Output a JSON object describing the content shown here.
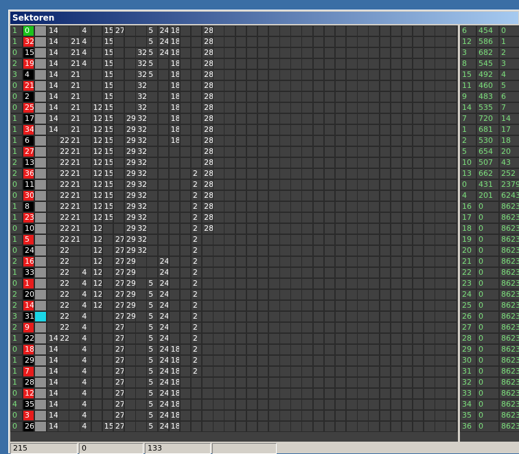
{
  "window": {
    "title": "Sektoren"
  },
  "colors": {
    "red": "#e81c1c",
    "green": "#1cc21c",
    "black": "#000000",
    "gray": "#909090",
    "cyan": "#1ad6e6",
    "grid": "#404040",
    "value_text": "#7ce07c"
  },
  "grid": {
    "col_count": 40,
    "rows": [
      {
        "a": "1",
        "id": "0",
        "mark": "green",
        "flag": "gray",
        "cells": {
          "3": "14",
          "6": "4",
          "8": "15",
          "9": "27",
          "12": "5",
          "13": "24",
          "14": "18",
          "17": "28"
        }
      },
      {
        "a": "1",
        "id": "32",
        "mark": "red",
        "flag": "gray",
        "cells": {
          "3": "14",
          "5": "21",
          "6": "4",
          "8": "15",
          "12": "5",
          "13": "24",
          "14": "18",
          "17": "28"
        }
      },
      {
        "a": "0",
        "id": "15",
        "mark": "black",
        "flag": "gray",
        "cells": {
          "3": "14",
          "5": "21",
          "6": "4",
          "8": "15",
          "11": "32",
          "12": "5",
          "13": "24",
          "14": "18",
          "17": "28"
        }
      },
      {
        "a": "2",
        "id": "19",
        "mark": "red",
        "flag": "gray",
        "cells": {
          "3": "14",
          "5": "21",
          "6": "4",
          "8": "15",
          "11": "32",
          "12": "5",
          "14": "18",
          "17": "28"
        }
      },
      {
        "a": "3",
        "id": "4",
        "mark": "black",
        "flag": "gray",
        "cells": {
          "3": "14",
          "5": "21",
          "8": "15",
          "11": "32",
          "12": "5",
          "14": "18",
          "17": "28"
        }
      },
      {
        "a": "0",
        "id": "21",
        "mark": "red",
        "flag": "gray",
        "cells": {
          "3": "14",
          "5": "21",
          "8": "15",
          "11": "32",
          "14": "18",
          "17": "28"
        }
      },
      {
        "a": "0",
        "id": "2",
        "mark": "black",
        "flag": "gray",
        "cells": {
          "3": "14",
          "5": "21",
          "8": "15",
          "11": "32",
          "14": "18",
          "17": "28"
        }
      },
      {
        "a": "0",
        "id": "25",
        "mark": "red",
        "flag": "gray",
        "cells": {
          "3": "14",
          "5": "21",
          "7": "12",
          "8": "15",
          "11": "32",
          "14": "18",
          "17": "28"
        }
      },
      {
        "a": "1",
        "id": "17",
        "mark": "black",
        "flag": "gray",
        "cells": {
          "3": "14",
          "5": "21",
          "7": "12",
          "8": "15",
          "10": "29",
          "11": "32",
          "14": "18",
          "17": "28"
        }
      },
      {
        "a": "1",
        "id": "34",
        "mark": "red",
        "flag": "gray",
        "cells": {
          "3": "14",
          "5": "21",
          "7": "12",
          "8": "15",
          "10": "29",
          "11": "32",
          "14": "18",
          "17": "28"
        }
      },
      {
        "a": "1",
        "id": "6",
        "mark": "black",
        "flag": "gray",
        "cells": {
          "4": "22",
          "5": "21",
          "7": "12",
          "8": "15",
          "10": "29",
          "11": "32",
          "14": "18",
          "17": "28"
        }
      },
      {
        "a": "1",
        "id": "27",
        "mark": "red",
        "flag": "gray",
        "cells": {
          "4": "22",
          "5": "21",
          "7": "12",
          "8": "15",
          "10": "29",
          "11": "32",
          "17": "28"
        }
      },
      {
        "a": "2",
        "id": "13",
        "mark": "black",
        "flag": "gray",
        "cells": {
          "4": "22",
          "5": "21",
          "7": "12",
          "8": "15",
          "10": "29",
          "11": "32",
          "17": "28"
        }
      },
      {
        "a": "2",
        "id": "36",
        "mark": "red",
        "flag": "gray",
        "cells": {
          "4": "22",
          "5": "21",
          "7": "12",
          "8": "15",
          "10": "29",
          "11": "32",
          "16": "2",
          "17": "28"
        }
      },
      {
        "a": "0",
        "id": "11",
        "mark": "black",
        "flag": "gray",
        "cells": {
          "4": "22",
          "5": "21",
          "7": "12",
          "8": "15",
          "10": "29",
          "11": "32",
          "16": "2",
          "17": "28"
        }
      },
      {
        "a": "0",
        "id": "30",
        "mark": "red",
        "flag": "gray",
        "cells": {
          "4": "22",
          "5": "21",
          "7": "12",
          "8": "15",
          "10": "29",
          "11": "32",
          "16": "2",
          "17": "28"
        }
      },
      {
        "a": "1",
        "id": "8",
        "mark": "black",
        "flag": "gray",
        "cells": {
          "4": "22",
          "5": "21",
          "7": "12",
          "8": "15",
          "10": "29",
          "11": "32",
          "16": "2",
          "17": "28"
        }
      },
      {
        "a": "1",
        "id": "23",
        "mark": "red",
        "flag": "gray",
        "cells": {
          "4": "22",
          "5": "21",
          "7": "12",
          "8": "15",
          "10": "29",
          "11": "32",
          "16": "2",
          "17": "28"
        }
      },
      {
        "a": "0",
        "id": "10",
        "mark": "black",
        "flag": "gray",
        "cells": {
          "4": "22",
          "5": "21",
          "7": "12",
          "10": "29",
          "11": "32",
          "16": "2",
          "17": "28"
        }
      },
      {
        "a": "1",
        "id": "5",
        "mark": "red",
        "flag": "gray",
        "cells": {
          "4": "22",
          "5": "21",
          "7": "12",
          "9": "27",
          "10": "29",
          "11": "32",
          "16": "2"
        }
      },
      {
        "a": "0",
        "id": "24",
        "mark": "black",
        "flag": "gray",
        "cells": {
          "4": "22",
          "7": "12",
          "9": "27",
          "10": "29",
          "11": "32",
          "16": "2"
        }
      },
      {
        "a": "2",
        "id": "16",
        "mark": "red",
        "flag": "gray",
        "cells": {
          "4": "22",
          "7": "12",
          "9": "27",
          "10": "29",
          "13": "24",
          "16": "2"
        }
      },
      {
        "a": "1",
        "id": "33",
        "mark": "black",
        "flag": "gray",
        "cells": {
          "4": "22",
          "6": "4",
          "7": "12",
          "9": "27",
          "10": "29",
          "13": "24",
          "16": "2"
        }
      },
      {
        "a": "0",
        "id": "1",
        "mark": "red",
        "flag": "gray",
        "cells": {
          "4": "22",
          "6": "4",
          "7": "12",
          "9": "27",
          "10": "29",
          "12": "5",
          "13": "24",
          "16": "2"
        }
      },
      {
        "a": "2",
        "id": "20",
        "mark": "black",
        "flag": "gray",
        "cells": {
          "4": "22",
          "6": "4",
          "7": "12",
          "9": "27",
          "10": "29",
          "12": "5",
          "13": "24",
          "16": "2"
        }
      },
      {
        "a": "2",
        "id": "14",
        "mark": "red",
        "flag": "gray",
        "cells": {
          "4": "22",
          "6": "4",
          "7": "12",
          "9": "27",
          "10": "29",
          "12": "5",
          "13": "24",
          "16": "2"
        }
      },
      {
        "a": "3",
        "id": "31",
        "mark": "black",
        "flag": "cyan",
        "cells": {
          "4": "22",
          "6": "4",
          "9": "27",
          "10": "29",
          "12": "5",
          "13": "24",
          "16": "2"
        }
      },
      {
        "a": "2",
        "id": "9",
        "mark": "red",
        "flag": "gray",
        "cells": {
          "4": "22",
          "6": "4",
          "9": "27",
          "12": "5",
          "13": "24",
          "16": "2"
        }
      },
      {
        "a": "1",
        "id": "22",
        "mark": "black",
        "flag": "gray",
        "cells": {
          "3": "14",
          "4": "22",
          "6": "4",
          "9": "27",
          "12": "5",
          "13": "24",
          "16": "2"
        }
      },
      {
        "a": "0",
        "id": "18",
        "mark": "red",
        "flag": "gray",
        "cells": {
          "3": "14",
          "6": "4",
          "9": "27",
          "12": "5",
          "13": "24",
          "14": "18",
          "16": "2"
        }
      },
      {
        "a": "1",
        "id": "29",
        "mark": "black",
        "flag": "gray",
        "cells": {
          "3": "14",
          "6": "4",
          "9": "27",
          "12": "5",
          "13": "24",
          "14": "18",
          "16": "2"
        }
      },
      {
        "a": "1",
        "id": "7",
        "mark": "red",
        "flag": "gray",
        "cells": {
          "3": "14",
          "6": "4",
          "9": "27",
          "12": "5",
          "13": "24",
          "14": "18",
          "16": "2"
        }
      },
      {
        "a": "1",
        "id": "28",
        "mark": "black",
        "flag": "gray",
        "cells": {
          "3": "14",
          "6": "4",
          "9": "27",
          "12": "5",
          "13": "24",
          "14": "18"
        }
      },
      {
        "a": "0",
        "id": "12",
        "mark": "red",
        "flag": "gray",
        "cells": {
          "3": "14",
          "6": "4",
          "9": "27",
          "12": "5",
          "13": "24",
          "14": "18"
        }
      },
      {
        "a": "4",
        "id": "35",
        "mark": "black",
        "flag": "gray",
        "cells": {
          "3": "14",
          "6": "4",
          "9": "27",
          "12": "5",
          "13": "24",
          "14": "18"
        }
      },
      {
        "a": "0",
        "id": "3",
        "mark": "red",
        "flag": "gray",
        "cells": {
          "3": "14",
          "6": "4",
          "9": "27",
          "12": "5",
          "13": "24",
          "14": "18"
        }
      },
      {
        "a": "0",
        "id": "26",
        "mark": "black",
        "flag": "gray",
        "cells": {
          "3": "14",
          "6": "4",
          "8": "15",
          "9": "27",
          "12": "5",
          "13": "24",
          "14": "18"
        }
      }
    ]
  },
  "side": {
    "rows": [
      [
        "6",
        "454",
        "0"
      ],
      [
        "12",
        "586",
        "1"
      ],
      [
        "3",
        "682",
        "2"
      ],
      [
        "8",
        "545",
        "3"
      ],
      [
        "15",
        "492",
        "4"
      ],
      [
        "11",
        "460",
        "5"
      ],
      [
        "9",
        "483",
        "6"
      ],
      [
        "14",
        "535",
        "7"
      ],
      [
        "7",
        "720",
        "14"
      ],
      [
        "1",
        "681",
        "17"
      ],
      [
        "2",
        "530",
        "18"
      ],
      [
        "5",
        "654",
        "20"
      ],
      [
        "10",
        "507",
        "43"
      ],
      [
        "13",
        "662",
        "252"
      ],
      [
        "0",
        "431",
        "2379"
      ],
      [
        "4",
        "201",
        "6243"
      ],
      [
        "16",
        "0",
        "8623"
      ],
      [
        "17",
        "0",
        "8623"
      ],
      [
        "18",
        "0",
        "8623"
      ],
      [
        "19",
        "0",
        "8623"
      ],
      [
        "20",
        "0",
        "8623"
      ],
      [
        "21",
        "0",
        "8623"
      ],
      [
        "22",
        "0",
        "8623"
      ],
      [
        "23",
        "0",
        "8623"
      ],
      [
        "24",
        "0",
        "8623"
      ],
      [
        "25",
        "0",
        "8623"
      ],
      [
        "26",
        "0",
        "8623"
      ],
      [
        "27",
        "0",
        "8623"
      ],
      [
        "28",
        "0",
        "8623"
      ],
      [
        "29",
        "0",
        "8623"
      ],
      [
        "30",
        "0",
        "8623"
      ],
      [
        "31",
        "0",
        "8623"
      ],
      [
        "32",
        "0",
        "8623"
      ],
      [
        "33",
        "0",
        "8623"
      ],
      [
        "34",
        "0",
        "8623"
      ],
      [
        "35",
        "0",
        "8623"
      ],
      [
        "36",
        "0",
        "8623"
      ]
    ]
  },
  "status": {
    "p1": "215",
    "p2": "0",
    "p3": "133",
    "p4": ""
  }
}
